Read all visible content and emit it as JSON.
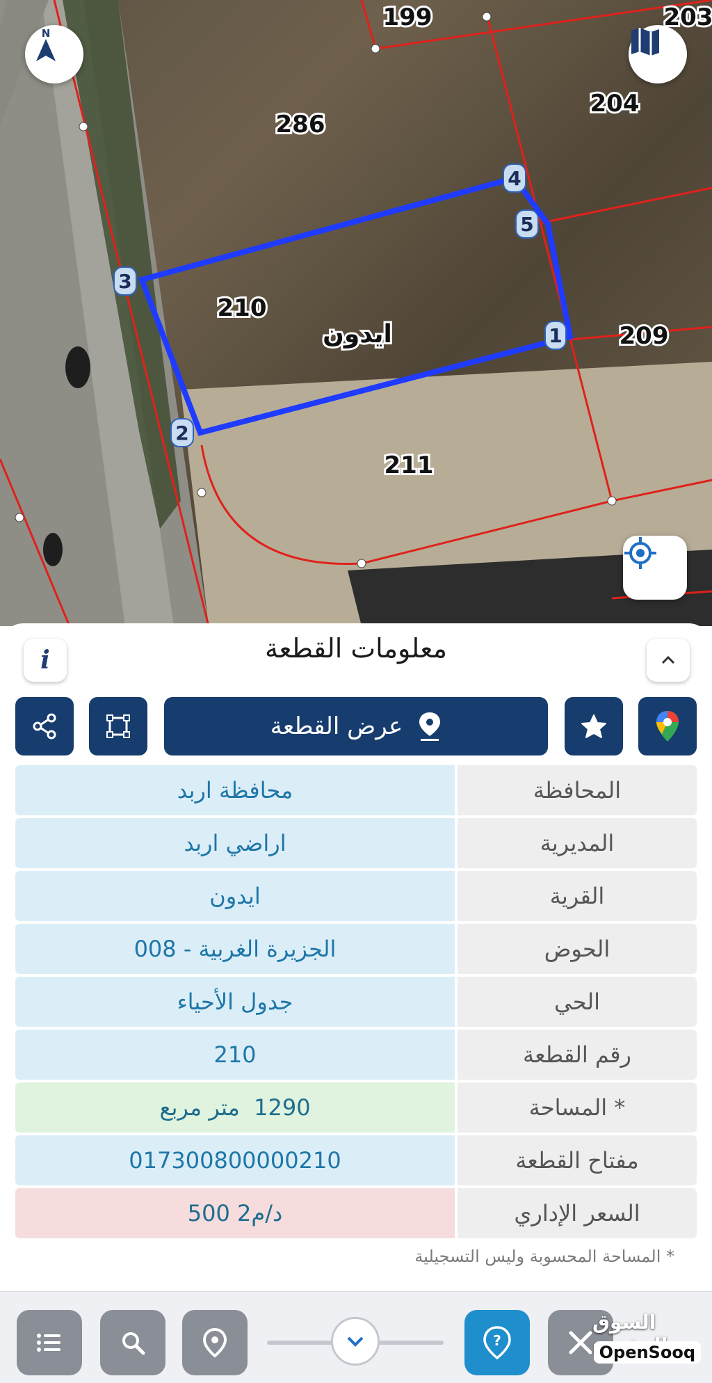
{
  "map": {
    "plots": [
      {
        "id": "p199",
        "label": "199"
      },
      {
        "id": "p203",
        "label": "203"
      },
      {
        "id": "p204",
        "label": "204"
      },
      {
        "id": "p286",
        "label": "286"
      },
      {
        "id": "p210",
        "label": "210"
      },
      {
        "id": "p209",
        "label": "209"
      },
      {
        "id": "p211",
        "label": "211"
      }
    ],
    "village_label": "ايدون",
    "vertices": [
      "1",
      "2",
      "3",
      "4",
      "5"
    ],
    "compass_letter": "N",
    "highlight_color": "#1f3bff",
    "boundary_color": "#e0211b"
  },
  "sheet": {
    "title": "معلومات القطعة",
    "info_icon_label": "i",
    "actions": {
      "view_plot_label": "عرض القطعة"
    }
  },
  "table": {
    "rows": [
      {
        "label": "المحافظة",
        "value": "محافظة اربد"
      },
      {
        "label": "المديرية",
        "value": "اراضي اربد"
      },
      {
        "label": "القرية",
        "value": "ايدون"
      },
      {
        "label": "الحوض",
        "value": "الجزيرة الغربية - 008"
      },
      {
        "label": "الحي",
        "value": "جدول الأحياء"
      },
      {
        "label": "رقم القطعة",
        "value": "210"
      },
      {
        "label": "المساحة *",
        "value": "1290  متر مربع"
      },
      {
        "label": "مفتاح القطعة",
        "value": "017300800000210"
      },
      {
        "label": "السعر الإداري",
        "value": "500 د/م2"
      }
    ]
  },
  "footnote": "* المساحة المحسوبة وليس التسجيلية",
  "watermark": {
    "arabic": "السوق المفتوح",
    "english": "OpenSooq"
  },
  "colors": {
    "primary": "#173d6e",
    "value_text": "#1e76a8",
    "value_bg": "#dbeef7",
    "area_bg": "#dff3df",
    "price_bg": "#f6dcdc",
    "active_tool": "#1f8ecc"
  }
}
